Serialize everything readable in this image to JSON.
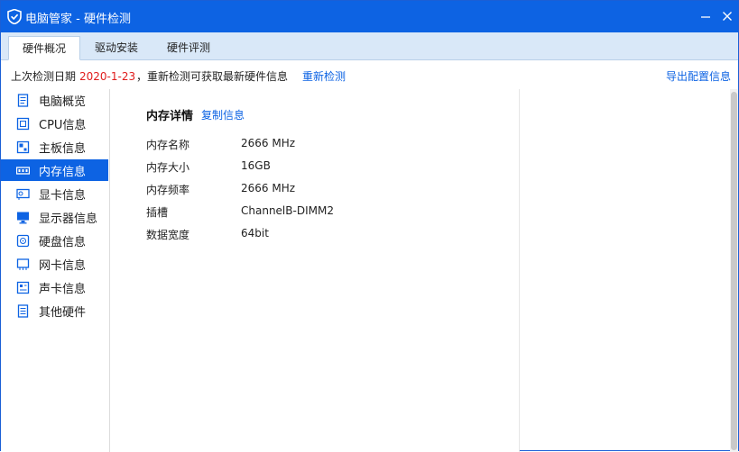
{
  "window": {
    "title": "电脑管家 - 硬件检测",
    "accent_color": "#0d63e3",
    "minimize_icon": "minimize-icon",
    "close_icon": "close-icon"
  },
  "tabs": [
    {
      "label": "硬件概况",
      "active": true
    },
    {
      "label": "驱动安装",
      "active": false
    },
    {
      "label": "硬件评测",
      "active": false
    }
  ],
  "infobar": {
    "prefix": "上次检测日期 ",
    "date": "2020-1-23",
    "date_color": "#e01c1c",
    "suffix": "，重新检测可获取最新硬件信息",
    "recheck": "重新检测",
    "export": "导出配置信息"
  },
  "sidebar": {
    "items": [
      {
        "label": "电脑概览",
        "icon": "overview-icon",
        "active": false
      },
      {
        "label": "CPU信息",
        "icon": "cpu-icon",
        "active": false
      },
      {
        "label": "主板信息",
        "icon": "motherboard-icon",
        "active": false
      },
      {
        "label": "内存信息",
        "icon": "memory-icon",
        "active": true
      },
      {
        "label": "显卡信息",
        "icon": "graphics-card-icon",
        "active": false
      },
      {
        "label": "显示器信息",
        "icon": "monitor-icon",
        "active": false
      },
      {
        "label": "硬盘信息",
        "icon": "hard-disk-icon",
        "active": false
      },
      {
        "label": "网卡信息",
        "icon": "network-card-icon",
        "active": false
      },
      {
        "label": "声卡信息",
        "icon": "sound-card-icon",
        "active": false
      },
      {
        "label": "其他硬件",
        "icon": "other-hardware-icon",
        "active": false
      }
    ]
  },
  "detail": {
    "heading": "内存详情",
    "copy_link": "复制信息",
    "rows": [
      {
        "key": "内存名称",
        "value": "2666 MHz"
      },
      {
        "key": "内存大小",
        "value": "16GB"
      },
      {
        "key": "内存频率",
        "value": "2666 MHz"
      },
      {
        "key": "插槽",
        "value": "ChannelB-DIMM2"
      },
      {
        "key": "数据宽度",
        "value": "64bit"
      }
    ]
  }
}
